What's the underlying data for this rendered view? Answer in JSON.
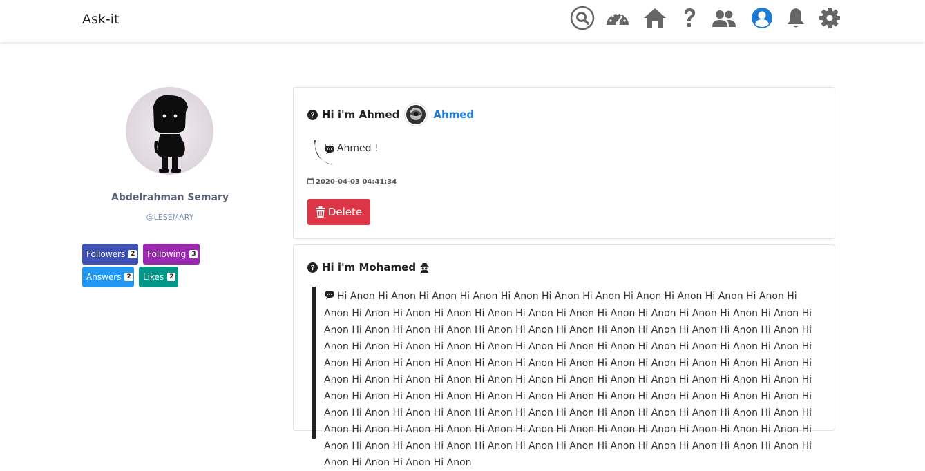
{
  "navbar": {
    "brand": "Ask-it",
    "icons": [
      "search-icon",
      "dashboard-icon",
      "home-icon",
      "question-icon",
      "users-icon",
      "user-circle-icon",
      "bell-icon",
      "gear-icon"
    ]
  },
  "profile": {
    "name": "Abdelrahman Semary",
    "handle": "@LESEMARY",
    "stats": {
      "followers_label": "Followers",
      "followers_count": "2",
      "following_label": "Following",
      "following_count": "3",
      "answers_label": "Answers",
      "answers_count": "2",
      "likes_label": "Likes",
      "likes_count": "2"
    }
  },
  "questions": [
    {
      "title": "Hi i'm Ahmed",
      "asker": "Ahmed",
      "answer": "Hi Ahmed !",
      "timestamp": "2020-04-03 04:41:34",
      "delete_label": "Delete"
    },
    {
      "title": "Hi i'm Mohamed",
      "answer": "Hi Anon Hi Anon Hi Anon Hi Anon Hi Anon Hi Anon Hi Anon Hi Anon Hi Anon Hi Anon Hi Anon Hi Anon Hi Anon Hi Anon Hi Anon Hi Anon Hi Anon Hi Anon Hi Anon Hi Anon Hi Anon Hi Anon Hi Anon Hi Anon Hi Anon Hi Anon Hi Anon Hi Anon Hi Anon Hi Anon Hi Anon Hi Anon Hi Anon Hi Anon Hi Anon Hi Anon Hi Anon Hi Anon Hi Anon Hi Anon Hi Anon Hi Anon Hi Anon Hi Anon Hi Anon Hi Anon Hi Anon Hi Anon Hi Anon Hi Anon Hi Anon Hi Anon Hi Anon Hi Anon Hi Anon Hi Anon Hi Anon Hi Anon Hi Anon Hi Anon Hi Anon Hi Anon Hi Anon Hi Anon Hi Anon Hi Anon Hi Anon Hi Anon Hi Anon Hi Anon Hi Anon Hi Anon Hi Anon Hi Anon Hi Anon Hi Anon Hi Anon Hi Anon Hi Anon Hi Anon Hi Anon Hi Anon Hi Anon Hi Anon Hi Anon Hi Anon Hi Anon Hi Anon Hi Anon Hi Anon Hi Anon Hi Anon Hi Anon Hi Anon Hi Anon Hi Anon Hi Anon Hi Anon Hi Anon Hi Anon Hi Anon Hi Anon Hi Anon Hi Anon Hi Anon Hi Anon Hi Anon Hi Anon Hi Anon Hi Anon Hi Anon Hi Anon Hi Anon Hi Anon Hi Anon Hi Anon Hi Anon Hi Anon Hi Anon Hi Anon Hi Anon Hi Anon Hi Anon"
    }
  ],
  "colors": {
    "delete": "#dc3545",
    "followers": "#3f51b5",
    "following": "#9c27b0",
    "answers": "#2196f3",
    "likes": "#009688",
    "link": "#1e7bd6"
  }
}
